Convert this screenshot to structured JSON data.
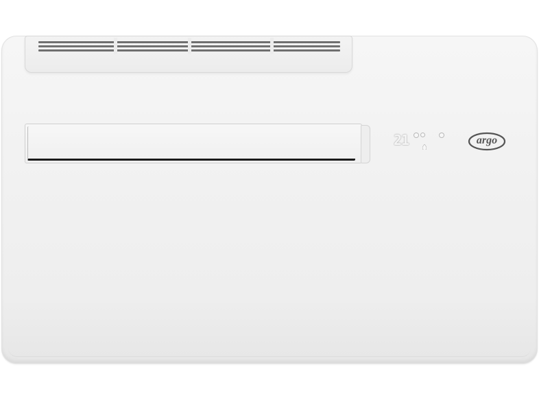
{
  "product": {
    "brand_logo_text": "argo",
    "display": {
      "temperature": "21",
      "indicators": [
        "fan-indicator",
        "mode-indicator",
        "water-drop-icon",
        "power-indicator"
      ]
    }
  },
  "colors": {
    "body": "#f1f1f1",
    "background": "#ffffff",
    "grille_slot": "#6f6f6f",
    "flap_edge": "#1b1b1b",
    "display_glow": "#f4f4f4",
    "logo": "#555555"
  }
}
